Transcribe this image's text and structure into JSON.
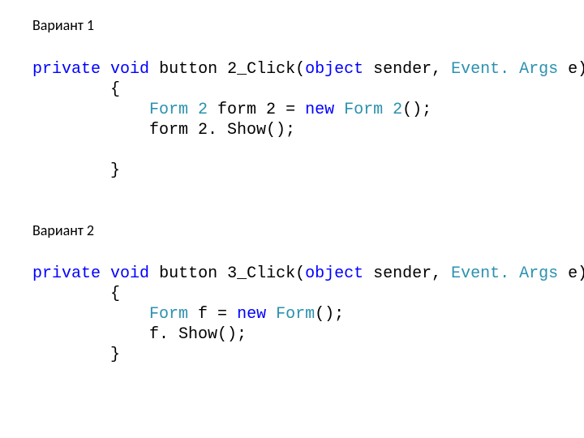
{
  "heading1": "Вариант 1",
  "heading2": "Вариант 2",
  "code1": {
    "l0_kw1": "private",
    "l0_sp1": " ",
    "l0_kw2": "void",
    "l0_sp2": " ",
    "l0_name": "button 2_Click(",
    "l0_kw3": "object",
    "l0_rest1": " sender, ",
    "l0_type1": "Event. Args",
    "l0_rest2": " e)",
    "l1_indent": "        {",
    "l2_indent": "            ",
    "l2_type1": "Form 2",
    "l2_sp1": " form 2 = ",
    "l2_kw1": "new",
    "l2_sp2": " ",
    "l2_type2": "Form 2",
    "l2_rest": "();",
    "l3_indent": "            form 2. Show();",
    "l4_blank": " ",
    "l5_indent": "        }"
  },
  "code2": {
    "l0_kw1": "private",
    "l0_sp1": " ",
    "l0_kw2": "void",
    "l0_sp2": " ",
    "l0_name": "button 3_Click(",
    "l0_kw3": "object",
    "l0_rest1": " sender, ",
    "l0_type1": "Event. Args",
    "l0_rest2": " e)",
    "l1_indent": "        {",
    "l2_indent": "            ",
    "l2_type1": "Form",
    "l2_sp1": " f = ",
    "l2_kw1": "new",
    "l2_sp2": " ",
    "l2_type2": "Form",
    "l2_rest": "();",
    "l3_indent": "            f. Show();",
    "l4_indent": "        }"
  }
}
